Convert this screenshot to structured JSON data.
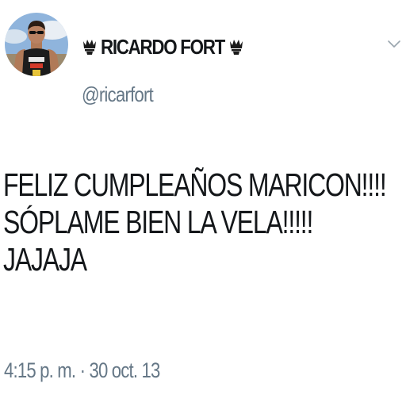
{
  "author": {
    "avatar_icon": "profile-photo",
    "crown_icon": "crown-icon",
    "display_name": "RICARDO FORT",
    "handle": "@ricarfort"
  },
  "menu": {
    "caret_icon": "chevron-down-icon"
  },
  "tweet": {
    "lines": [
      "FELIZ CUMPLEAÑOS MARICON!!!!",
      "SÓPLAME BIEN LA VELA!!!!!",
      "JAJAJA"
    ],
    "timestamp": "4:15 p. m. · 30 oct. 13"
  },
  "colors": {
    "text": "#14171a",
    "secondary": "#657786",
    "background": "#ffffff"
  }
}
